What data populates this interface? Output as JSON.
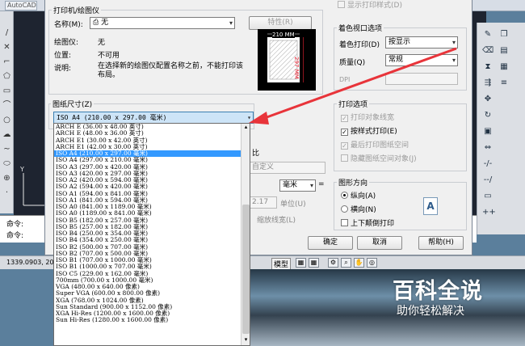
{
  "cad": {
    "title": "AutoCAD",
    "command_lines": [
      "命令:",
      "命令:"
    ],
    "coordinates": "1339.0903, 20",
    "model_tab": "模型"
  },
  "dialog": {
    "printer_group": "打印机/绘图仪",
    "name_label": "名称(M):",
    "name_value": "无",
    "properties_button": "特性(R)",
    "plotter_label": "绘图仪:",
    "plotter_value": "无",
    "location_label": "位置:",
    "location_value": "不可用",
    "description_label": "说明:",
    "description_value": "在选择新的绘图仪配置名称之前，不能打印该布局。",
    "preview_width": "210 MM",
    "preview_height": "297 MM",
    "paper_size_group": "图纸尺寸(Z)",
    "paper_size_selected": "ISO A4 (210.00 x 297.00 毫米)",
    "paper_sizes": [
      "ARCH E (36.00 x 48.00 英寸)",
      "ARCH E (48.00 x 36.00 英寸)",
      "ARCH E1 (30.00 x 42.00 英寸)",
      "ARCH E1 (42.00 x 30.00 英寸)",
      "ISO A4 (210.00 x 297.00 毫米)",
      "ISO A4 (297.00 x 210.00 毫米)",
      "ISO A3 (297.00 x 420.00 毫米)",
      "ISO A3 (420.00 x 297.00 毫米)",
      "ISO A2 (420.00 x 594.00 毫米)",
      "ISO A2 (594.00 x 420.00 毫米)",
      "ISO A1 (594.00 x 841.00 毫米)",
      "ISO A1 (841.00 x 594.00 毫米)",
      "ISO A0 (841.00 x 1189.00 毫米)",
      "ISO A0 (1189.00 x 841.00 毫米)",
      "ISO B5 (182.00 x 257.00 毫米)",
      "ISO B5 (257.00 x 182.00 毫米)",
      "ISO B4 (250.00 x 354.00 毫米)",
      "ISO B4 (354.00 x 250.00 毫米)",
      "ISO B2 (500.00 x 707.00 毫米)",
      "ISO B2 (707.00 x 500.00 毫米)",
      "ISO B1 (707.00 x 1000.00 毫米)",
      "ISO B1 (1000.00 x 707.00 毫米)",
      "ISO C5 (229.00 x 162.00 毫米)",
      "700mm (700.00 x 1000.00 毫米)",
      "VGA (480.00 x 640.00 像素)",
      "Super VGA (600.00 x 800.00 像素)",
      "XGA (768.00 x 1024.00 像素)",
      "Sun Standard (900.00 x 1152.00 像素)",
      "XGA Hi-Res (1200.00 x 1600.00 像素)",
      "Sun Hi-Res (1280.00 x 1600.00 像素)"
    ],
    "selected_index": 4,
    "hidden_scale_label": "比",
    "hidden_custom": "自定义",
    "hidden_unit": "毫米",
    "hidden_value": "2.17",
    "hidden_unit_label": "单位(U)",
    "hidden_scale_lineweights": "缩放线宽(L)",
    "show_plot_styles": "显示打印样式(D)",
    "shaded_group": "着色视口选项",
    "shade_plot_label": "着色打印(D)",
    "shade_plot_value": "按显示",
    "quality_label": "质量(Q)",
    "quality_value": "常规",
    "dpi_label": "DPI",
    "plot_options_group": "打印选项",
    "opt_object_lineweights": "打印对象线宽",
    "opt_plot_with_styles": "按样式打印(E)",
    "opt_paperspace_last": "最后打印图纸空间",
    "opt_hide_paperspace": "隐藏图纸空间对象(J)",
    "orientation_group": "图形方向",
    "portrait": "纵向(A)",
    "landscape": "横向(N)",
    "upside_down": "上下颠倒打印",
    "orientation_icon_letter": "A",
    "ok_button": "确定",
    "cancel_button": "取消",
    "help_button": "帮助(H)"
  },
  "watermark": {
    "title": "百科全说",
    "subtitle": "助你轻松解决"
  },
  "colors": {
    "arrow": "#e8343a",
    "selection": "#3399ff"
  }
}
